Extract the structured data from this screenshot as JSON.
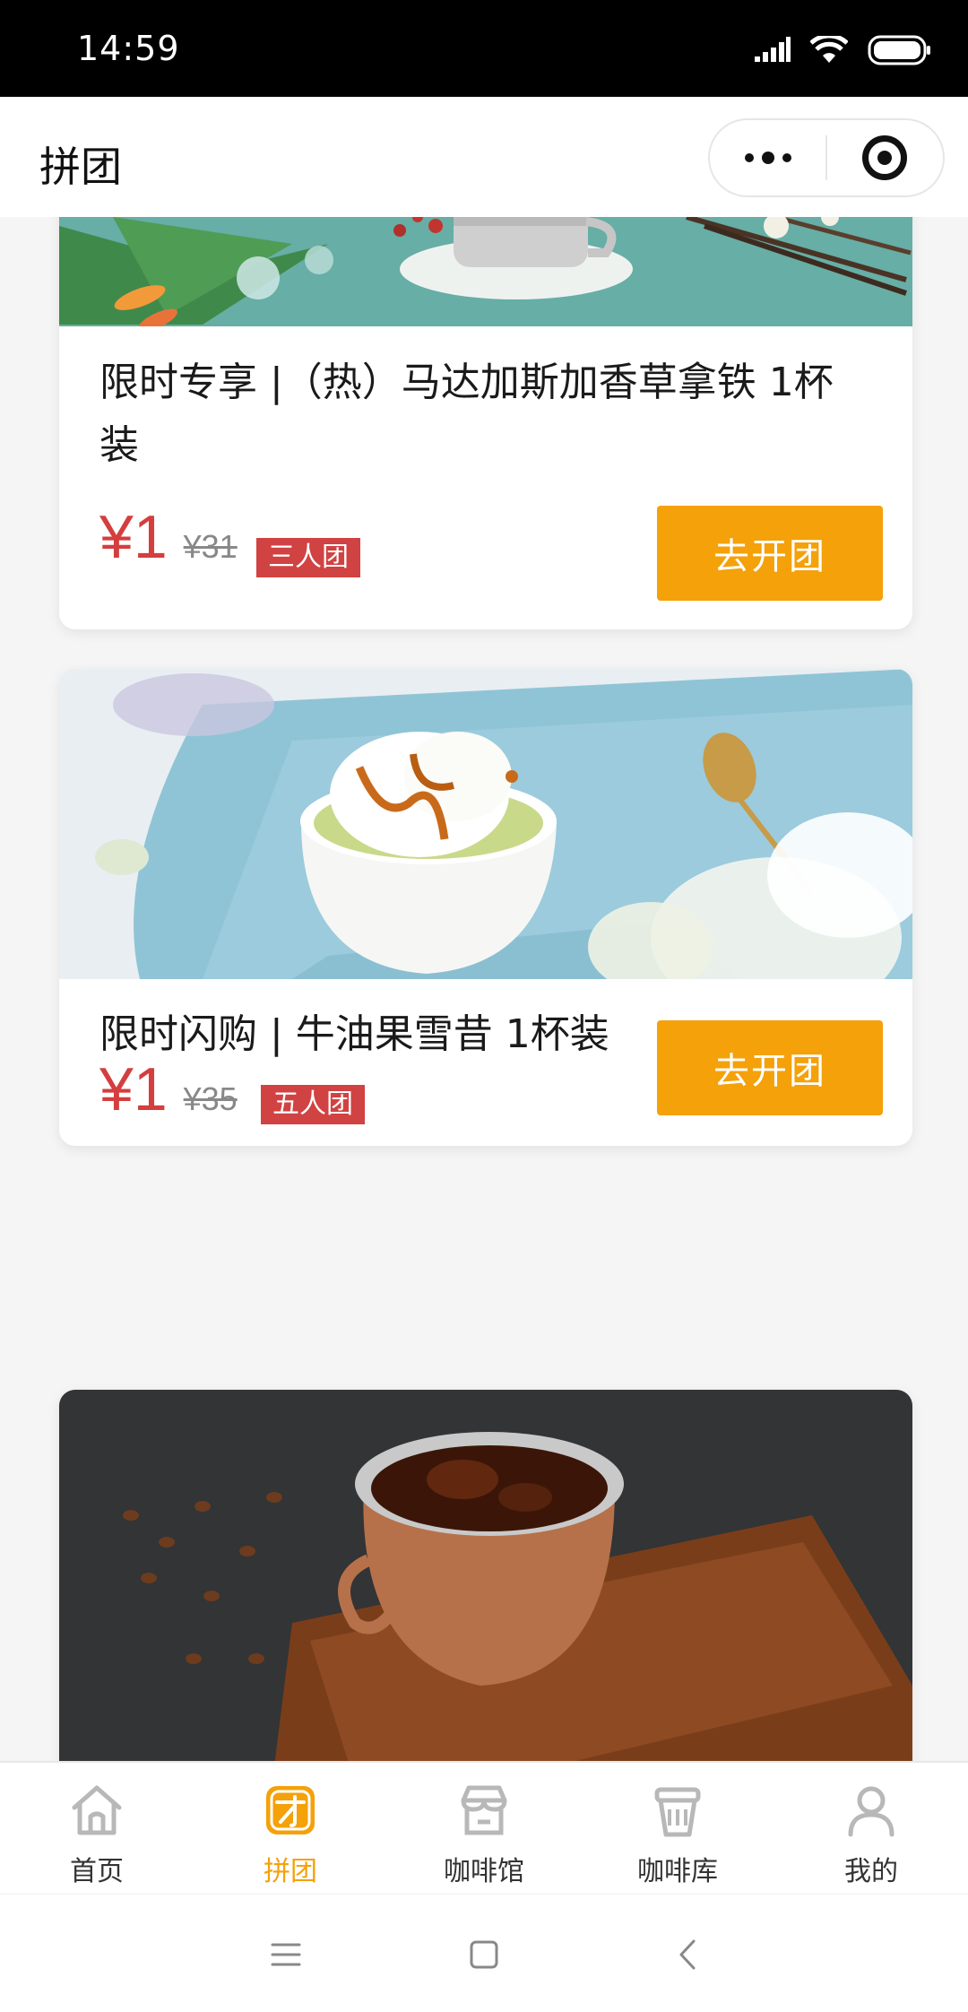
{
  "status_bar": {
    "time": "14:59"
  },
  "header": {
    "title": "拼团"
  },
  "products": [
    {
      "title": "限时专享 |（热）马达加斯加香草拿铁 1杯装",
      "price": "¥1",
      "original_price": "¥31",
      "group_badge": "三人团",
      "button_label": "去开团"
    },
    {
      "title": "限时闪购 | 牛油果雪昔 1杯装",
      "price": "¥1",
      "original_price": "¥35",
      "group_badge": "五人团",
      "button_label": "去开团"
    }
  ],
  "tabs": [
    {
      "label": "首页",
      "icon": "home-icon",
      "active": false
    },
    {
      "label": "拼团",
      "icon": "group-buy-icon",
      "active": true
    },
    {
      "label": "咖啡馆",
      "icon": "store-icon",
      "active": false
    },
    {
      "label": "咖啡库",
      "icon": "coffee-cup-icon",
      "active": false
    },
    {
      "label": "我的",
      "icon": "profile-icon",
      "active": false
    }
  ],
  "colors": {
    "accent": "#f4a10a",
    "price_red": "#d43e3e",
    "badge_red": "#d14242",
    "inactive_icon": "#b8b8b8"
  }
}
